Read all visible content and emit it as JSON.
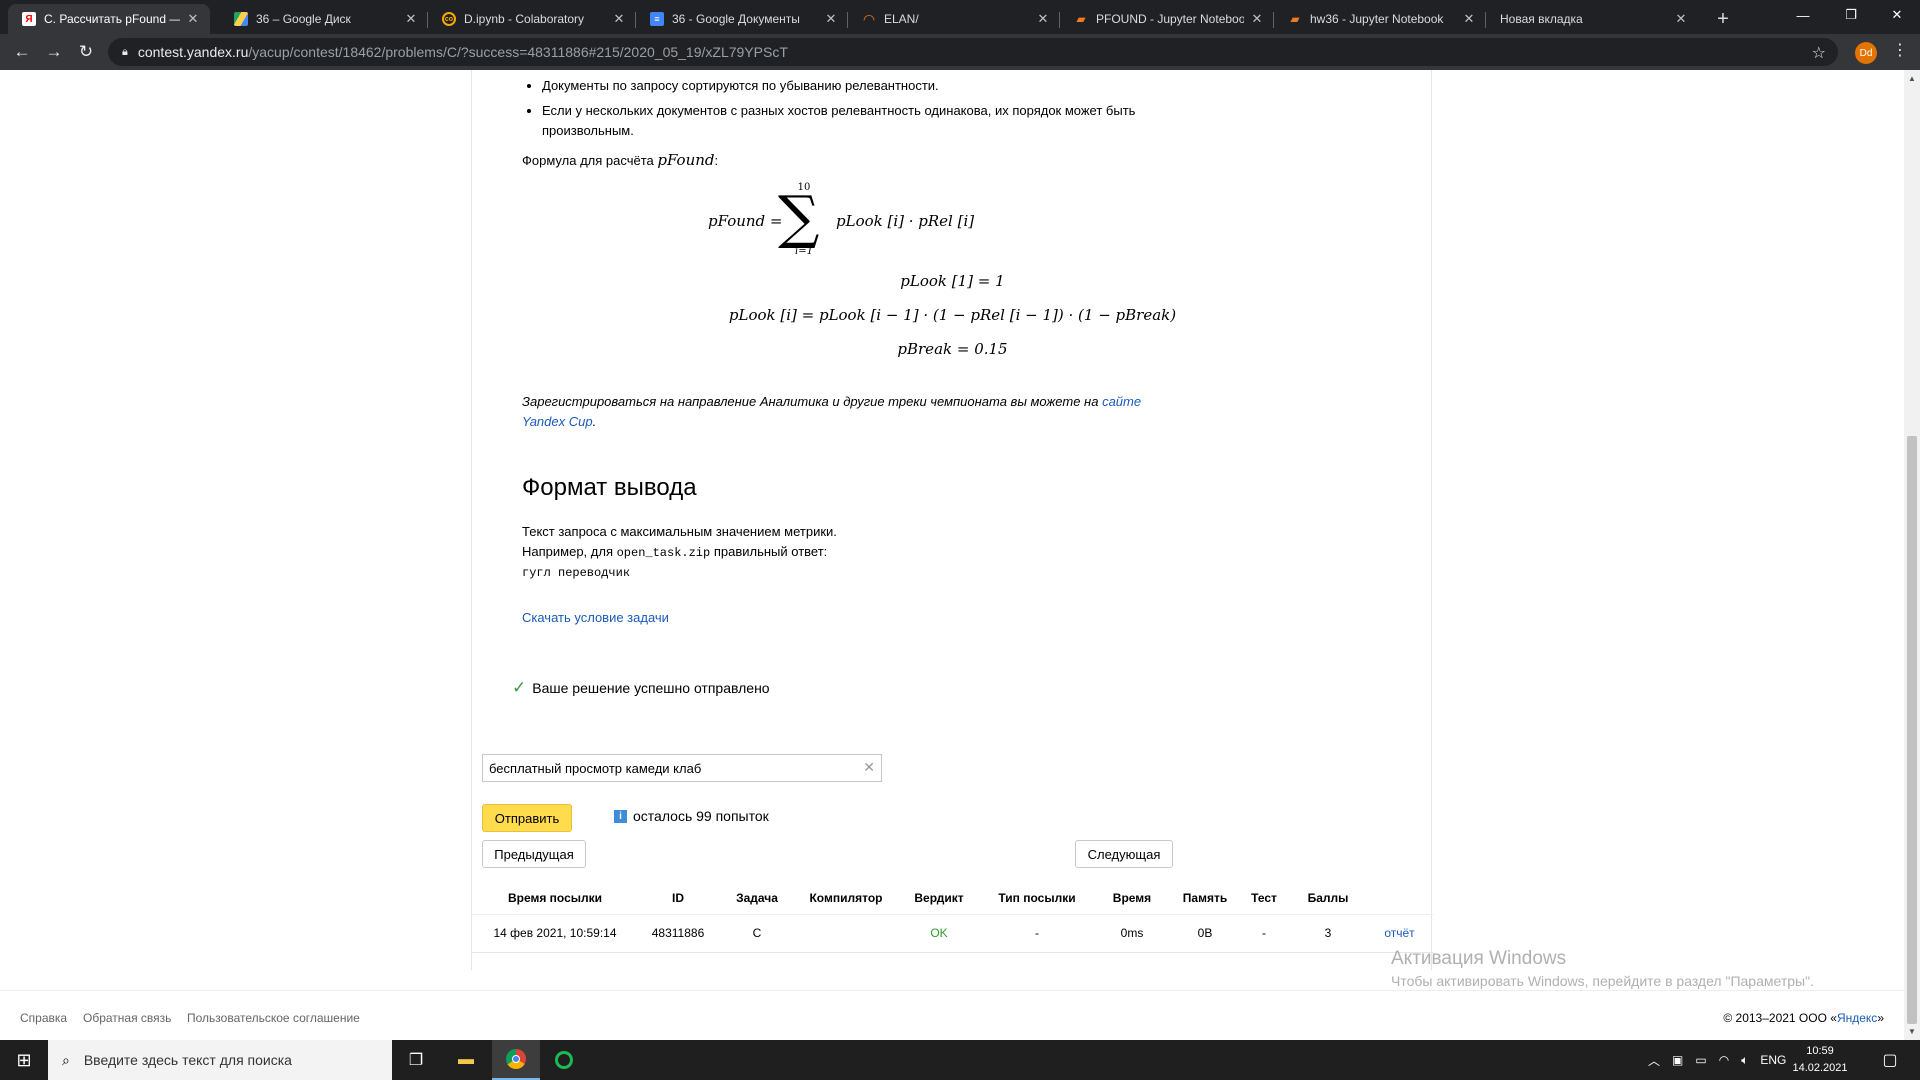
{
  "browser": {
    "tabs": [
      {
        "title": "C. Рассчитать pFound — А",
        "icon": "yandex-icon",
        "color": "#ff0000"
      },
      {
        "title": "36 – Google Диск",
        "icon": "google-drive-icon",
        "color": "#1fa463"
      },
      {
        "title": "D.ipynb - Colaboratory",
        "icon": "colab-icon",
        "color": "#f9ab00"
      },
      {
        "title": "36 - Google Документы",
        "icon": "google-docs-icon",
        "color": "#4285f4"
      },
      {
        "title": "ELAN/",
        "icon": "jupyter-icon",
        "color": "#f37726"
      },
      {
        "title": "PFOUND - Jupyter Noteboo",
        "icon": "jupyter-notebook-icon",
        "color": "#f37726"
      },
      {
        "title": "hw36 - Jupyter Notebook",
        "icon": "jupyter-notebook-icon",
        "color": "#f37726"
      },
      {
        "title": "Новая вкладка",
        "icon": "new-tab-icon",
        "color": "#35363a"
      }
    ],
    "url_host": "contest.yandex.ru",
    "url_path": "/yacup/contest/18462/problems/C/?success=48311886#215/2020_05_19/xZL79YPScT",
    "profile_initials": "Dd"
  },
  "problem": {
    "bullets": [
      "Документы по запросу сортируются по убыванию релевантности.",
      "Если у нескольких документов с разных хостов релевантность одинакова, их порядок может быть произвольным."
    ],
    "formula_intro": "Формула для расчёта ",
    "formula_var": "pFound",
    "formula_colon": ":",
    "f1_lhs": "pFound =",
    "f1_sum_top": "10",
    "f1_sum_bottom": "i=1",
    "f1_rhs": "pLook [i] · pRel [i]",
    "f2": "pLook [1] = 1",
    "f3": "pLook [i] = pLook [i − 1] · (1 − pRel [i − 1]) · (1 − pBreak)",
    "f4": "pBreak = 0.15",
    "note": "Зарегистрироваться на направление Аналитика и другие треки чемпионата вы можете на",
    "note_link": "сайте Yandex Cup",
    "note_end": ".",
    "output_heading": "Формат вывода",
    "output_line1": "Текст запроса с максимальным значением метрики.",
    "output_line2_pre": "Например, для ",
    "output_line2_code": "open_task.zip",
    "output_line2_post": " правильный ответ:",
    "output_answer": "гугл переводчик",
    "download_link": "Скачать условие задачи"
  },
  "submission": {
    "success_message": "Ваше решение успешно отправлено",
    "answer_value": "бесплатный просмотр камеди клаб",
    "submit_label": "Отправить",
    "attempts_text": "осталось 99 попыток",
    "prev_label": "Предыдущая",
    "next_label": "Следующая"
  },
  "table": {
    "headers": [
      "Время посылки",
      "ID",
      "Задача",
      "Компилятор",
      "Вердикт",
      "Тип посылки",
      "Время",
      "Память",
      "Тест",
      "Баллы"
    ],
    "row": {
      "time": "14 фев 2021, 10:59:14",
      "id": "48311886",
      "task": "C",
      "compiler": "",
      "verdict": "OK",
      "type": "-",
      "exec_time": "0ms",
      "memory": "0B",
      "test": "-",
      "score": "3",
      "report": "отчёт"
    }
  },
  "footer": {
    "links": [
      "Справка",
      "Обратная связь",
      "Пользовательское соглашение"
    ],
    "copyright": "© 2013–2021  ООО «",
    "company": "Яндекс",
    "copyright_end": "»"
  },
  "watermark": {
    "title": "Активация Windows",
    "subtitle": "Чтобы активировать Windows, перейдите в раздел \"Параметры\"."
  },
  "taskbar": {
    "search_placeholder": "Введите здесь текст для поиска",
    "lang": "ENG",
    "time": "10:59",
    "date": "14.02.2021"
  }
}
